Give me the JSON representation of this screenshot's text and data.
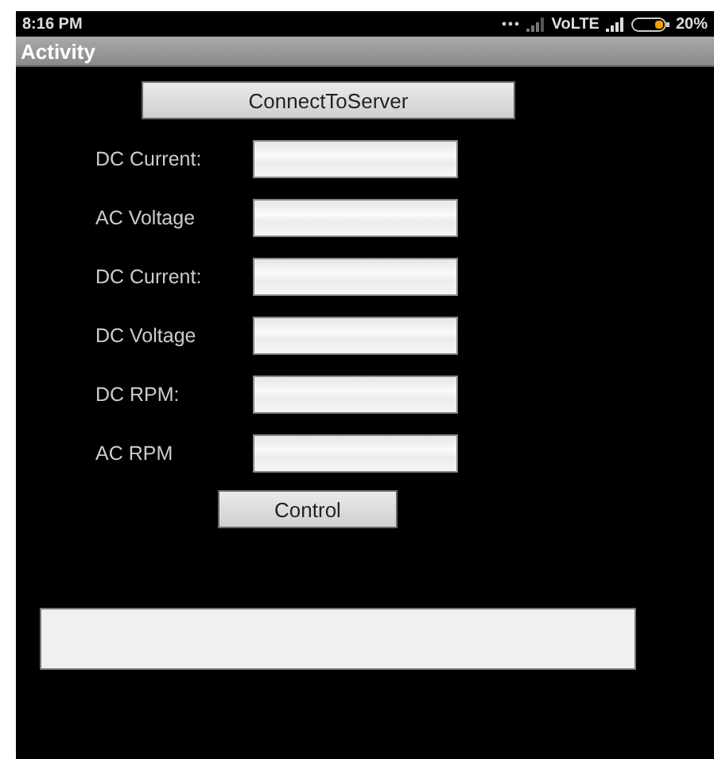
{
  "status_bar": {
    "time": "8:16 PM",
    "network": "VoLTE",
    "battery": "20%"
  },
  "title_bar": {
    "title": "Activity"
  },
  "connect_button": {
    "label": "ConnectToServer"
  },
  "fields": [
    {
      "label": "DC Current:"
    },
    {
      "label": "AC Voltage"
    },
    {
      "label": "DC Current:"
    },
    {
      "label": "DC Voltage"
    },
    {
      "label": "DC RPM:"
    },
    {
      "label": "AC RPM"
    }
  ],
  "control_button": {
    "label": "Control"
  }
}
